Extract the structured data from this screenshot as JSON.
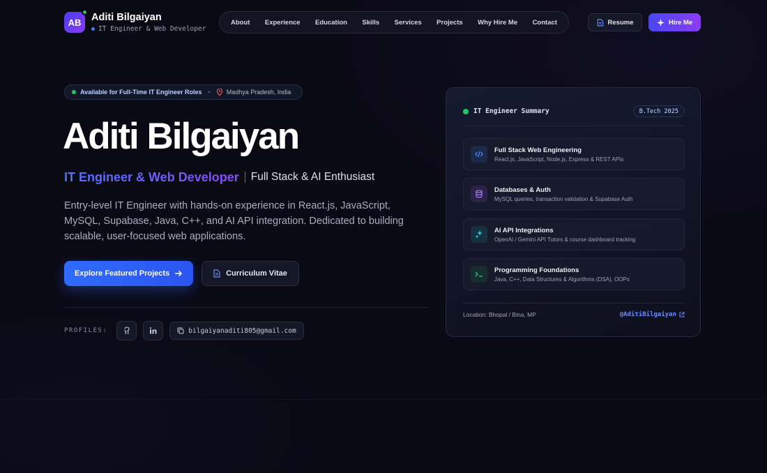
{
  "brand": {
    "initials": "AB",
    "name": "Aditi Bilgaiyan",
    "role": "IT Engineer & Web Developer"
  },
  "nav": [
    "About",
    "Experience",
    "Education",
    "Skills",
    "Services",
    "Projects",
    "Why Hire Me",
    "Contact"
  ],
  "header_actions": {
    "resume": "Resume",
    "hire": "Hire Me"
  },
  "hero": {
    "availability": "Available for Full-Time IT Engineer Roles",
    "location": "Madhya Pradesh, India",
    "name": "Aditi Bilgaiyan",
    "role": "IT Engineer & Web Developer",
    "tagline": "Full Stack & AI Enthusiast",
    "description": "Entry-level IT Engineer with hands-on experience in React.js, JavaScript, MySQL, Supabase, Java, C++, and AI API integration. Dedicated to building scalable, user-focused web applications.",
    "primary_cta": "Explore Featured Projects",
    "secondary_cta": "Curriculum Vitae",
    "profiles_label": "PROFILES:",
    "email": "bilgaiyanaditi805@gmail.com"
  },
  "summary_card": {
    "title": "IT Engineer Summary",
    "badge": "B.Tech 2025",
    "items": [
      {
        "title": "Full Stack Web Engineering",
        "desc": "React.js, JavaScript, Node.js, Express & REST APIs",
        "icon": "code-icon",
        "color": "#3b82f6"
      },
      {
        "title": "Databases & Auth",
        "desc": "MySQL queries, transaction validation & Supabase Auth",
        "icon": "database-icon",
        "color": "#a855f7"
      },
      {
        "title": "AI API Integrations",
        "desc": "OpenAI / Gemini API Tutors & course dashboard tracking",
        "icon": "sparkle-icon",
        "color": "#22d3ee"
      },
      {
        "title": "Programming Foundations",
        "desc": "Java, C++, Data Structures & Algorithms (DSA), OOPs",
        "icon": "terminal-icon",
        "color": "#22c55e"
      }
    ],
    "location": "Location: Bhopal / Bina, MP",
    "handle": "@AditiBilgaiyan"
  }
}
